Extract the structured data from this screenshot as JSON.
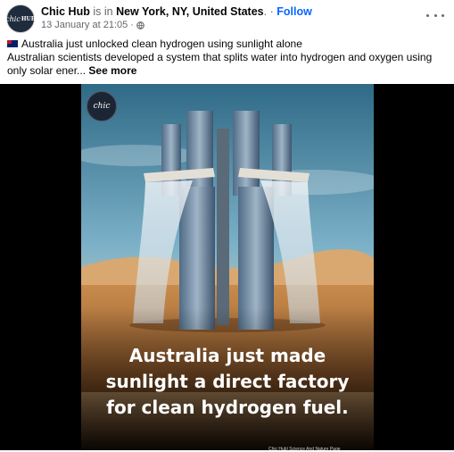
{
  "post": {
    "author": "Chic Hub",
    "is_in": "is in",
    "location": "New York, NY, United States",
    "separator": ".",
    "dot": "·",
    "follow": "Follow",
    "timestamp": "13 January at 21:05",
    "timestamp_dot": "·",
    "privacy_icon": "globe-icon",
    "avatar_text": "chic",
    "avatar_sub": "HUB",
    "text_line1": "Australia just unlocked clean hydrogen using sunlight alone",
    "text_line2": "Australian scientists developed a system that splits water into hydrogen and oxygen using only solar ener...",
    "see_more": "See more"
  },
  "image": {
    "logo_text": "chic",
    "caption_line1": "Australia just made",
    "caption_line2": "sunlight a direct factory",
    "caption_line3": "for clean hydrogen fuel.",
    "credit": "Chic Hub| Science And Nature Page"
  },
  "colors": {
    "link": "#0866ff",
    "muted": "#65676b",
    "text": "#050505"
  }
}
